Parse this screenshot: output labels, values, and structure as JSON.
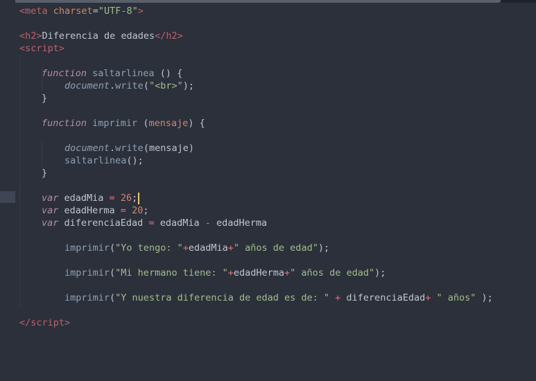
{
  "editor": {
    "lines": {
      "l1": {
        "a": "<",
        "b": "meta",
        "c": " charset",
        "d": "=",
        "e": "\"UTF-8\"",
        "f": ">"
      },
      "l3": {
        "a": "<",
        "b": "h2",
        "c": ">",
        "d": "Diferencia de edades",
        "e": "</",
        "f": "h2",
        "g": ">"
      },
      "l4": {
        "a": "<",
        "b": "script",
        "c": ">"
      },
      "l6": {
        "a": "function",
        "b": " saltarlinea",
        "c": " () {"
      },
      "l7": {
        "a": "document",
        "b": ".",
        "c": "write",
        "d": "(",
        "e": "\"<br>\"",
        "f": ");"
      },
      "l8": {
        "a": "}"
      },
      "l10": {
        "a": "function",
        "b": " imprimir",
        "c": " (",
        "d": "mensaje",
        "e": ") {"
      },
      "l12": {
        "a": "document",
        "b": ".",
        "c": "write",
        "d": "(mensaje)"
      },
      "l13": {
        "a": "saltarlinea",
        "b": "();"
      },
      "l14": {
        "a": "}"
      },
      "l16": {
        "a": "var",
        "b": " edadMia ",
        "c": "=",
        "d": " ",
        "e": "26",
        "f": ";"
      },
      "l17": {
        "a": "var",
        "b": " edadHerma ",
        "c": "=",
        "d": " ",
        "e": "20",
        "f": ";"
      },
      "l18": {
        "a": "var",
        "b": " diferenciaEdad ",
        "c": "=",
        "d": " edadMia ",
        "e": "-",
        "f": " edadHerma"
      },
      "l20": {
        "a": "imprimir",
        "b": "(",
        "c": "\"Yo tengo: \"",
        "d": "+",
        "e": "edadMia",
        "f": "+",
        "g": "\" años de edad\"",
        "h": ");"
      },
      "l22": {
        "a": "imprimir",
        "b": "(",
        "c": "\"Mi hermano tiene: \"",
        "d": "+",
        "e": "edadHerma",
        "f": "+",
        "g": "\" años de edad\"",
        "h": ");"
      },
      "l24": {
        "a": "imprimir",
        "b": "(",
        "c": "\"Y nuestra diferencia de edad es de: \"",
        "d": " + ",
        "e": "diferenciaEdad",
        "f": "+",
        "g": " \" años\"",
        "h": " );"
      },
      "l26": {
        "a": "</",
        "b": "script",
        "c": ">"
      }
    }
  },
  "colors": {
    "background": "#2b303b",
    "tag": "#bf616a",
    "string": "#a3be8c",
    "keyword": "#b48ead",
    "function": "#8fa1b3",
    "number": "#d08770",
    "cursor": "#f0c674"
  }
}
